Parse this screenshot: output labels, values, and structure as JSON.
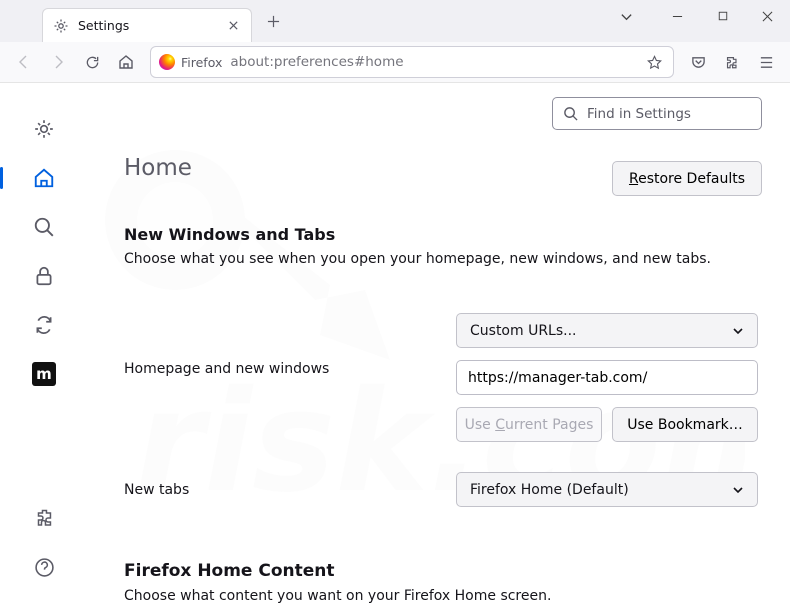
{
  "titlebar": {
    "tab": {
      "label": "Settings",
      "icon": "gear-icon"
    }
  },
  "toolbar": {
    "identity_label": "Firefox",
    "url": "about:preferences#home"
  },
  "sidebar": {
    "items": [
      {
        "name": "general",
        "glyph": "gear"
      },
      {
        "name": "home",
        "glyph": "home"
      },
      {
        "name": "search",
        "glyph": "search"
      },
      {
        "name": "privacy",
        "glyph": "lock"
      },
      {
        "name": "sync",
        "glyph": "sync"
      },
      {
        "name": "m",
        "glyph": "m"
      }
    ]
  },
  "find": {
    "placeholder": "Find in Settings"
  },
  "page": {
    "title": "Home",
    "restore": "Restore Defaults",
    "section1_heading": "New Windows and Tabs",
    "section1_desc": "Choose what you see when you open your homepage, new windows, and new tabs.",
    "home_select": "Custom URLs...",
    "home_label": "Homepage and new windows",
    "home_url": "https://manager-tab.com/",
    "use_current": "Use Current Pages",
    "use_bookmark": "Use Bookmark…",
    "newtabs_label": "New tabs",
    "newtabs_select": "Firefox Home (Default)",
    "section2_heading": "Firefox Home Content",
    "section2_desc": "Choose what content you want on your Firefox Home screen."
  }
}
